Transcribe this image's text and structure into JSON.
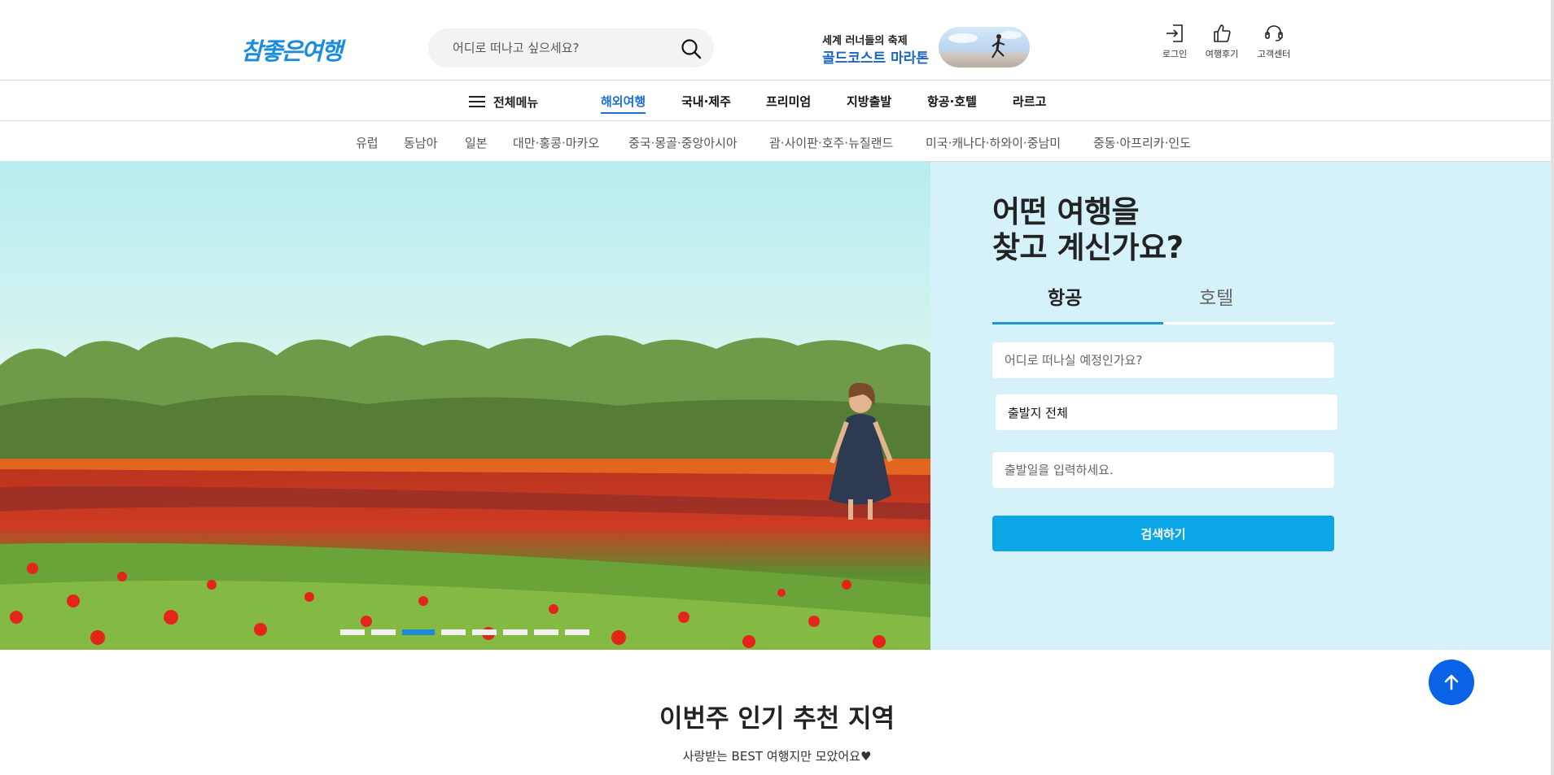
{
  "header": {
    "logo_text": "참좋은여행",
    "search_placeholder": "어디로 떠나고 싶으세요?",
    "promo": {
      "line1": "세계 러너들의 축제",
      "line2": "골드코스트 마라톤"
    },
    "utils": [
      {
        "label": "로그인",
        "icon": "login-icon"
      },
      {
        "label": "여행후기",
        "icon": "thumbs-up-icon"
      },
      {
        "label": "고객센터",
        "icon": "headset-icon"
      }
    ]
  },
  "main_nav": {
    "all_menu_label": "전체메뉴",
    "items": [
      "해외여행",
      "국내·제주",
      "프리미엄",
      "지방출발",
      "항공·호텔",
      "라르고"
    ],
    "active_index": 0
  },
  "sub_nav": {
    "items": [
      "유럽",
      "동남아",
      "일본",
      "대만·홍콩·마카오",
      "중국·몽골·중앙아시아",
      "괌·사이판·호주·뉴질랜드",
      "미국·캐나다·하와이·중남미",
      "중동·아프리카·인도"
    ]
  },
  "hero": {
    "slide_count": 8,
    "active_slide": 2
  },
  "booking": {
    "title": "어떤 여행을\n찾고 계신가요?",
    "tabs": [
      "항공",
      "호텔"
    ],
    "active_tab": 0,
    "destination_placeholder": "어디로 떠나실 예정인가요?",
    "departure_value": "출발지 전체",
    "date_placeholder": "출발일을 입력하세요.",
    "submit_label": "검색하기"
  },
  "section": {
    "title": "이번주 인기 추천 지역",
    "subtitle": "사랑받는 BEST 여행지만 모았어요♥"
  },
  "colors": {
    "accent": "#1c6fd8",
    "panel_bg": "#d5f2fb",
    "button": "#0aa6e6",
    "top_button": "#0a62e6"
  }
}
